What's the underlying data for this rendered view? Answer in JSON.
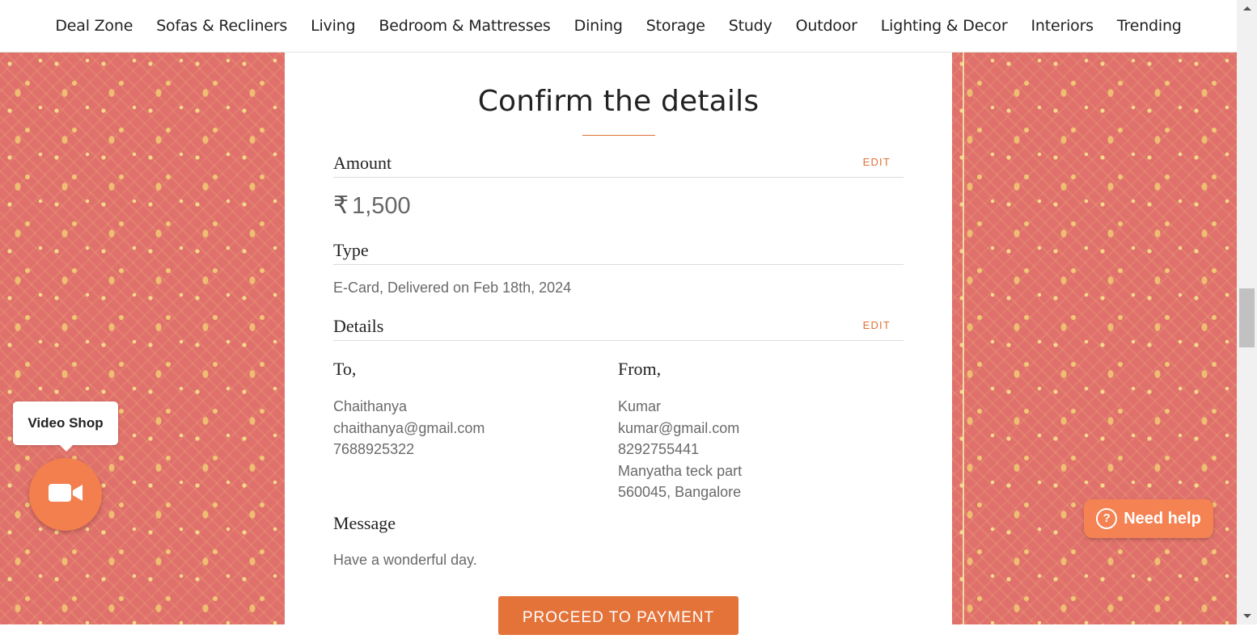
{
  "nav": {
    "items": [
      "Deal Zone",
      "Sofas & Recliners",
      "Living",
      "Bedroom & Mattresses",
      "Dining",
      "Storage",
      "Study",
      "Outdoor",
      "Lighting & Decor",
      "Interiors",
      "Trending"
    ]
  },
  "page": {
    "title": "Confirm the details"
  },
  "amount": {
    "label": "Amount",
    "edit": "EDIT",
    "currency_symbol": "₹",
    "value": "1,500"
  },
  "type": {
    "label": "Type",
    "value": "E-Card, Delivered on Feb 18th, 2024"
  },
  "details": {
    "label": "Details",
    "edit": "EDIT",
    "to": {
      "heading": "To,",
      "name": "Chaithanya",
      "email": "chaithanya@gmail.com",
      "phone": "7688925322"
    },
    "from": {
      "heading": "From,",
      "name": "Kumar",
      "email": "kumar@gmail.com",
      "phone": "8292755441",
      "address_line1": "Manyatha teck part",
      "address_line2": "560045, Bangalore"
    }
  },
  "message": {
    "label": "Message",
    "text": "Have a wonderful day."
  },
  "actions": {
    "proceed": "PROCEED TO PAYMENT"
  },
  "widgets": {
    "video_shop": "Video Shop",
    "video_icon": "video-camera-icon",
    "need_help": "Need help",
    "help_icon": "question-circle-icon"
  },
  "colors": {
    "accent": "#e4733a",
    "pattern_bg": "#e0706b",
    "pattern_fg": "#f4d88a"
  }
}
